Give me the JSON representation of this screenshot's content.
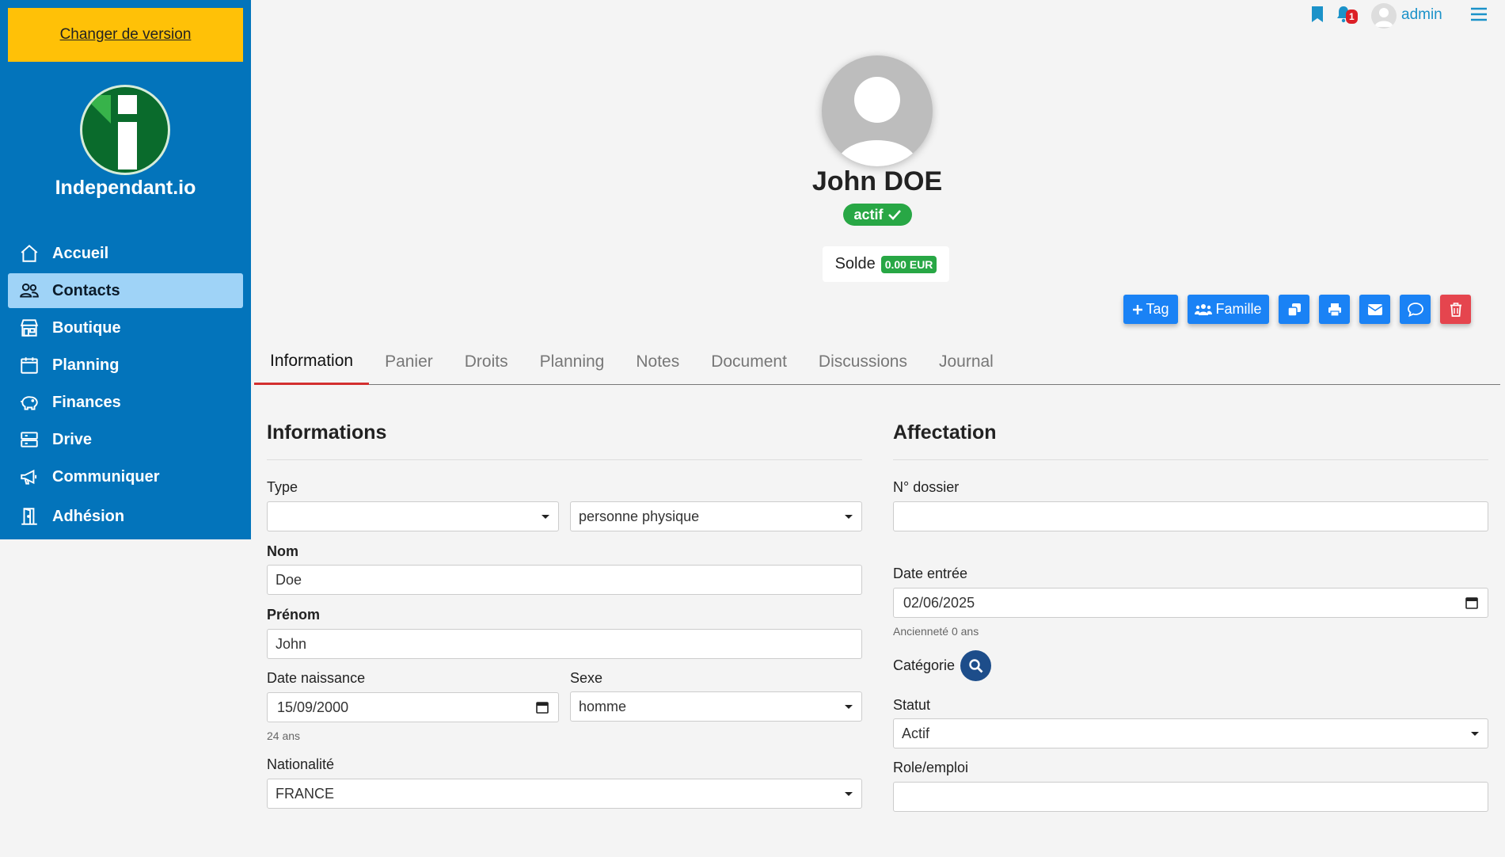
{
  "sidebar": {
    "version_label": "Changer de version",
    "brand": "Independant.io",
    "items": [
      {
        "label": "Accueil",
        "icon": "home-icon"
      },
      {
        "label": "Contacts",
        "icon": "users-icon"
      },
      {
        "label": "Boutique",
        "icon": "store-icon"
      },
      {
        "label": "Planning",
        "icon": "calendar-icon"
      },
      {
        "label": "Finances",
        "icon": "piggy-bank-icon"
      },
      {
        "label": "Drive",
        "icon": "server-icon"
      },
      {
        "label": "Communiquer",
        "icon": "megaphone-icon"
      },
      {
        "label": "Adhésion",
        "icon": "door-icon"
      }
    ],
    "active_item": "Contacts"
  },
  "topbar": {
    "notification_count": "1",
    "user": "admin"
  },
  "profile": {
    "name": "John DOE",
    "status": "actif",
    "solde_label": "Solde",
    "solde_value": "0.00 EUR"
  },
  "actions": {
    "tag_label": "Tag",
    "famille_label": "Famille"
  },
  "tabs": [
    {
      "label": "Information"
    },
    {
      "label": "Panier"
    },
    {
      "label": "Droits"
    },
    {
      "label": "Planning"
    },
    {
      "label": "Notes"
    },
    {
      "label": "Document"
    },
    {
      "label": "Discussions"
    },
    {
      "label": "Journal"
    }
  ],
  "informations": {
    "title": "Informations",
    "type_label": "Type",
    "type_value": "",
    "subtype_value": "personne physique",
    "nom_label": "Nom",
    "nom_value": "Doe",
    "prenom_label": "Prénom",
    "prenom_value": "John",
    "date_naissance_label": "Date naissance",
    "date_naissance_value": "15/09/2000",
    "age": "24 ans",
    "sexe_label": "Sexe",
    "sexe_value": "homme",
    "nationalite_label": "Nationalité",
    "nationalite_value": "FRANCE"
  },
  "affectation": {
    "title": "Affectation",
    "dossier_label": "N° dossier",
    "dossier_value": "",
    "date_entree_label": "Date entrée",
    "date_entree_value": "02/06/2025",
    "anciennete": "Ancienneté 0 ans",
    "categorie_label": "Catégorie",
    "statut_label": "Statut",
    "statut_value": "Actif",
    "role_label": "Role/emploi",
    "role_value": ""
  },
  "colors": {
    "sidebar": "#0374bb",
    "version_button": "#ffc107",
    "active_nav": "#9fd3f7",
    "status_green": "#28a745",
    "primary_button": "#1a82f5",
    "danger_button": "#e5454e",
    "active_tab_underline": "#d32f2f"
  }
}
